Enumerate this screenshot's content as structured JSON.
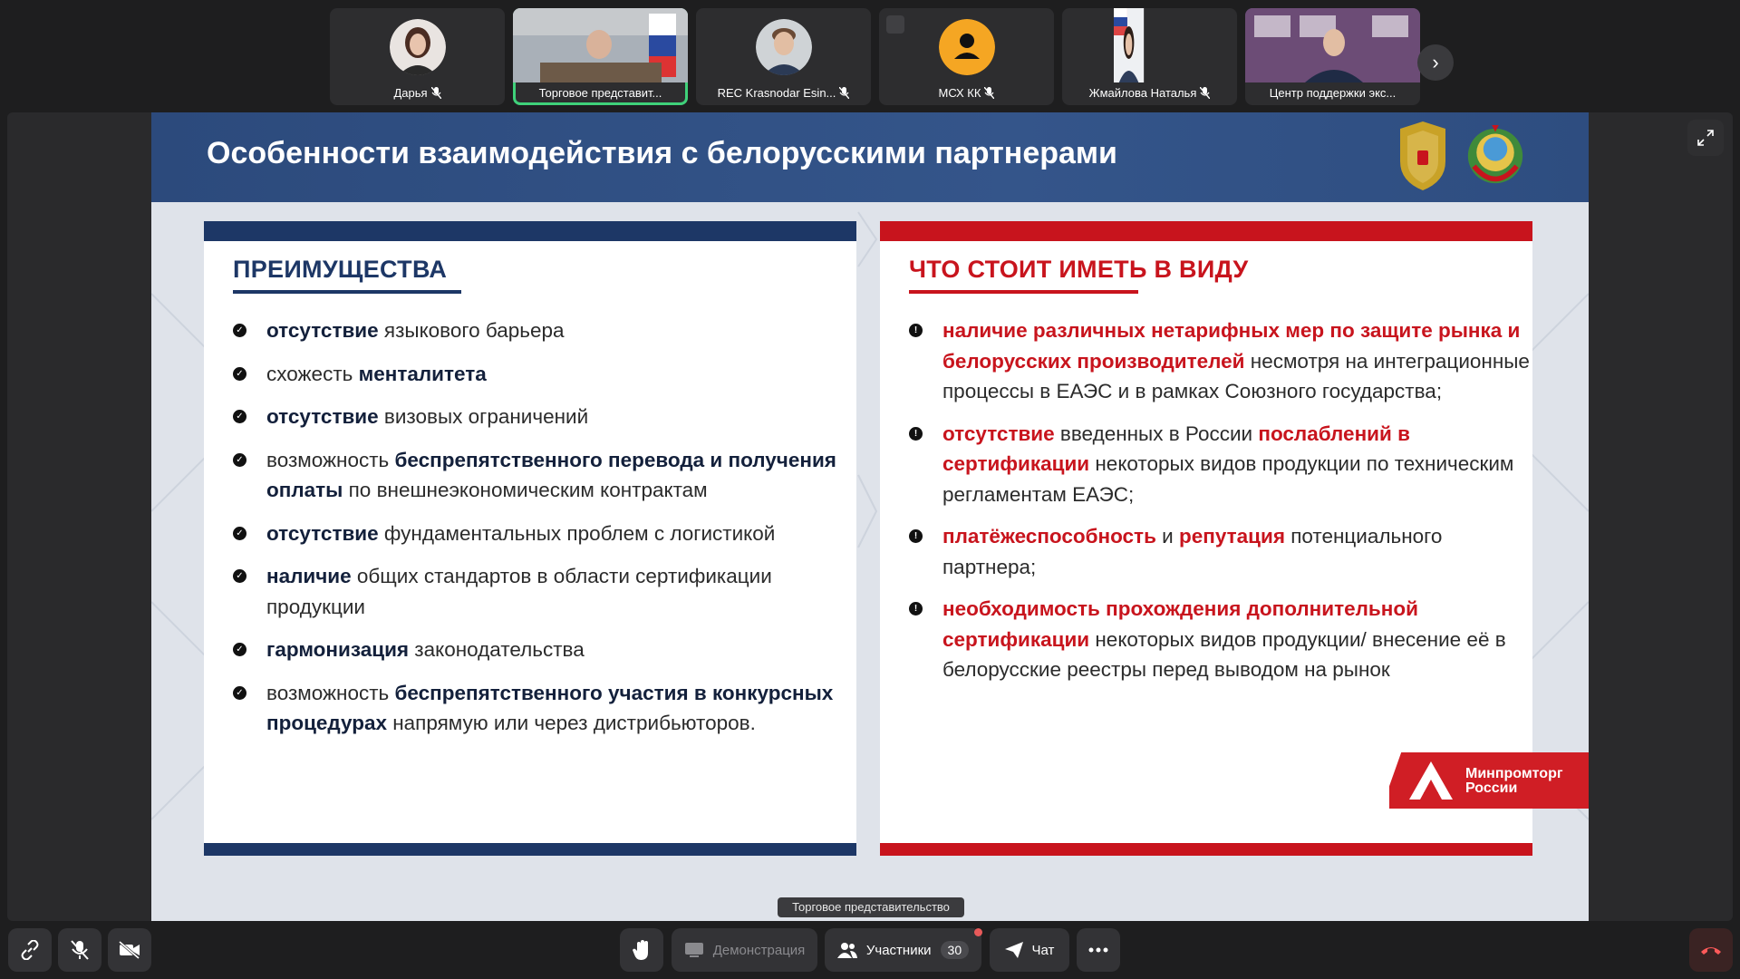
{
  "participants": [
    {
      "name": "Дарья",
      "active": false
    },
    {
      "name": "Торговое представит...",
      "active": true
    },
    {
      "name": "REC Krasnodar Esin...",
      "active": false
    },
    {
      "name": "МСХ КК",
      "active": false
    },
    {
      "name": "Жмайлова Наталья",
      "active": false
    },
    {
      "name": "Центр поддержки экс...",
      "active": false
    }
  ],
  "slide": {
    "title": "Особенности взаимодействия с белорусскими партнерами",
    "left": {
      "heading": "ПРЕИМУЩЕСТВА",
      "items": [
        [
          {
            "t": "отсутствие",
            "s": "b"
          },
          {
            "t": " языкового барьера"
          }
        ],
        [
          {
            "t": "схожесть "
          },
          {
            "t": "менталитета",
            "s": "b"
          }
        ],
        [
          {
            "t": "отсутствие",
            "s": "b"
          },
          {
            "t": " визовых ограничений"
          }
        ],
        [
          {
            "t": "возможность "
          },
          {
            "t": "беспрепятственного перевода и получения оплаты",
            "s": "b"
          },
          {
            "t": " по внешнеэкономическим контрактам"
          }
        ],
        [
          {
            "t": "отсутствие",
            "s": "b"
          },
          {
            "t": " фундаментальных проблем с логистикой"
          }
        ],
        [
          {
            "t": "наличие",
            "s": "b"
          },
          {
            "t": " общих стандартов в области сертификации продукции"
          }
        ],
        [
          {
            "t": "гармонизация",
            "s": "b"
          },
          {
            "t": " законодательства"
          }
        ],
        [
          {
            "t": "возможность "
          },
          {
            "t": "беспрепятственного участия в конкурсных процедурах",
            "s": "b"
          },
          {
            "t": " напрямую или через дистрибьюторов."
          }
        ]
      ]
    },
    "right": {
      "heading": "ЧТО СТОИТ ИМЕТЬ В ВИДУ",
      "items": [
        [
          {
            "t": "наличие различных нетарифных мер по защите рынка и белорусских производителей",
            "s": "r"
          },
          {
            "t": " несмотря на интеграционные процессы в ЕАЭС и в рамках Союзного государства;"
          }
        ],
        [
          {
            "t": "отсутствие",
            "s": "r"
          },
          {
            "t": " введенных в России "
          },
          {
            "t": "послаблений в сертификации",
            "s": "r"
          },
          {
            "t": " некоторых видов продукции по техническим регламентам ЕАЭС;"
          }
        ],
        [
          {
            "t": "платёжеспособность",
            "s": "r"
          },
          {
            "t": " и "
          },
          {
            "t": "репутация",
            "s": "r"
          },
          {
            "t": " потенциального партнера;"
          }
        ],
        [
          {
            "t": "необходимость прохождения дополнительной сертификации",
            "s": "r"
          },
          {
            "t": " некоторых видов продукции/ внесение её в белорусские реестры перед выводом на рынок"
          }
        ]
      ]
    },
    "logo_line1": "Минпромторг",
    "logo_line2": "России"
  },
  "tooltip": "Торговое представительство",
  "toolbar": {
    "screen_share_label": "Демонстрация",
    "participants_label": "Участники",
    "participants_count": "30",
    "chat_label": "Чат"
  },
  "icons": {
    "link": "link-icon",
    "mic": "mic-off-icon",
    "camera": "camera-off-icon",
    "hand": "raise-hand-icon",
    "screen": "screen-share-icon",
    "participants": "participants-icon",
    "chat": "chat-icon",
    "more": "more-icon",
    "hangup": "hangup-icon",
    "expand": "expand-icon"
  },
  "colors": {
    "navy": "#1d3766",
    "red": "#c8141d",
    "active_border": "#3fd17a"
  }
}
